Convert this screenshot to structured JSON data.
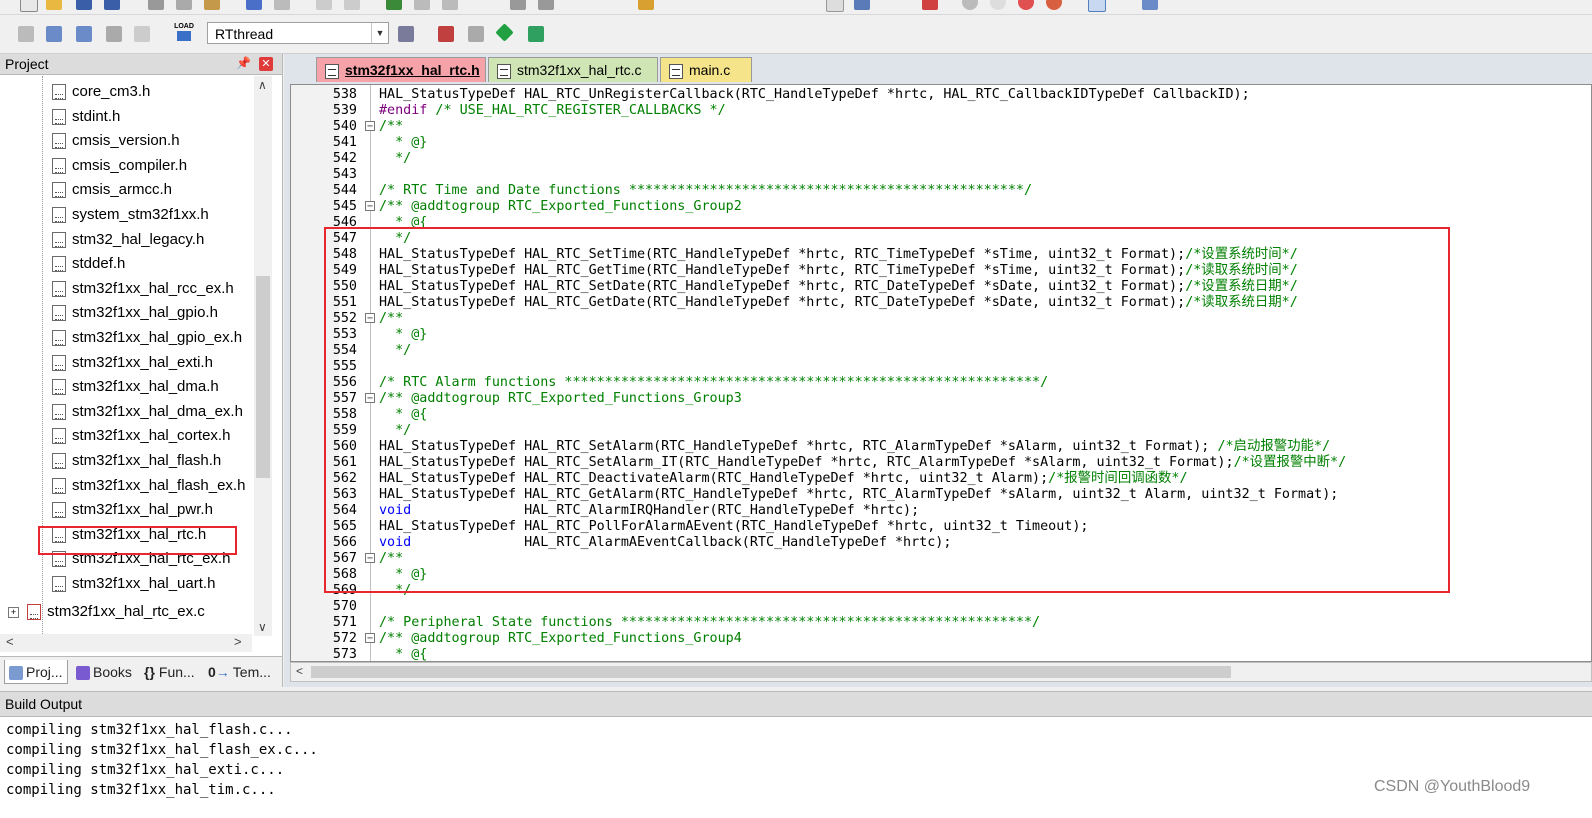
{
  "toolbar": {
    "target_name": "RTthread",
    "load_label": "LOAD"
  },
  "project_panel": {
    "title": "Project",
    "files": [
      "core_cm3.h",
      "stdint.h",
      "cmsis_version.h",
      "cmsis_compiler.h",
      "cmsis_armcc.h",
      "system_stm32f1xx.h",
      "stm32_hal_legacy.h",
      "stddef.h",
      "stm32f1xx_hal_rcc_ex.h",
      "stm32f1xx_hal_gpio.h",
      "stm32f1xx_hal_gpio_ex.h",
      "stm32f1xx_hal_exti.h",
      "stm32f1xx_hal_dma.h",
      "stm32f1xx_hal_dma_ex.h",
      "stm32f1xx_hal_cortex.h",
      "stm32f1xx_hal_flash.h",
      "stm32f1xx_hal_flash_ex.h",
      "stm32f1xx_hal_pwr.h",
      "stm32f1xx_hal_rtc.h",
      "stm32f1xx_hal_rtc_ex.h",
      "stm32f1xx_hal_uart.h"
    ],
    "group_item": "stm32f1xx_hal_rtc_ex.c",
    "tabs": [
      "Proj...",
      "Books",
      "Fun...",
      "Tem..."
    ]
  },
  "editor": {
    "tabs": [
      "stm32f1xx_hal_rtc.h",
      "stm32f1xx_hal_rtc.c",
      "main.c"
    ],
    "lines": [
      {
        "n": "538",
        "fold": "",
        "segs": [
          {
            "t": "HAL_StatusTypeDef HAL_RTC_UnRegisterCallback(RTC_HandleTypeDef *hrtc, HAL_RTC_CallbackIDTypeDef CallbackID);",
            "c": ""
          }
        ]
      },
      {
        "n": "539",
        "fold": "",
        "segs": [
          {
            "t": "#endif",
            "c": "pp"
          },
          {
            "t": " /* USE_HAL_RTC_REGISTER_CALLBACKS */",
            "c": "cm"
          }
        ]
      },
      {
        "n": "540",
        "fold": "-",
        "segs": [
          {
            "t": "/**",
            "c": "cm"
          }
        ]
      },
      {
        "n": "541",
        "fold": "",
        "segs": [
          {
            "t": "  * @}",
            "c": "cm"
          }
        ]
      },
      {
        "n": "542",
        "fold": "",
        "segs": [
          {
            "t": "  */",
            "c": "cm"
          }
        ]
      },
      {
        "n": "543",
        "fold": "",
        "segs": [
          {
            "t": "",
            "c": ""
          }
        ]
      },
      {
        "n": "544",
        "fold": "",
        "segs": [
          {
            "t": "/* RTC Time and Date functions *************************************************/",
            "c": "cm"
          }
        ]
      },
      {
        "n": "545",
        "fold": "-",
        "segs": [
          {
            "t": "/** @addtogroup RTC_Exported_Functions_Group2",
            "c": "cm"
          }
        ]
      },
      {
        "n": "546",
        "fold": "",
        "segs": [
          {
            "t": "  * @{",
            "c": "cm"
          }
        ]
      },
      {
        "n": "547",
        "fold": "",
        "segs": [
          {
            "t": "  */",
            "c": "cm"
          }
        ]
      },
      {
        "n": "548",
        "fold": "",
        "segs": [
          {
            "t": "HAL_StatusTypeDef HAL_RTC_SetTime(RTC_HandleTypeDef *hrtc, RTC_TimeTypeDef *sTime, uint32_t Format);",
            "c": ""
          },
          {
            "t": "/*设置系统时间*/",
            "c": "cm"
          }
        ]
      },
      {
        "n": "549",
        "fold": "",
        "segs": [
          {
            "t": "HAL_StatusTypeDef HAL_RTC_GetTime(RTC_HandleTypeDef *hrtc, RTC_TimeTypeDef *sTime, uint32_t Format);",
            "c": ""
          },
          {
            "t": "/*读取系统时间*/",
            "c": "cm"
          }
        ]
      },
      {
        "n": "550",
        "fold": "",
        "segs": [
          {
            "t": "HAL_StatusTypeDef HAL_RTC_SetDate(RTC_HandleTypeDef *hrtc, RTC_DateTypeDef *sDate, uint32_t Format);",
            "c": ""
          },
          {
            "t": "/*设置系统日期*/",
            "c": "cm"
          }
        ]
      },
      {
        "n": "551",
        "fold": "",
        "segs": [
          {
            "t": "HAL_StatusTypeDef HAL_RTC_GetDate(RTC_HandleTypeDef *hrtc, RTC_DateTypeDef *sDate, uint32_t Format);",
            "c": ""
          },
          {
            "t": "/*读取系统日期*/",
            "c": "cm"
          }
        ]
      },
      {
        "n": "552",
        "fold": "-",
        "segs": [
          {
            "t": "/**",
            "c": "cm"
          }
        ]
      },
      {
        "n": "553",
        "fold": "",
        "segs": [
          {
            "t": "  * @}",
            "c": "cm"
          }
        ]
      },
      {
        "n": "554",
        "fold": "",
        "segs": [
          {
            "t": "  */",
            "c": "cm"
          }
        ]
      },
      {
        "n": "555",
        "fold": "",
        "segs": [
          {
            "t": "",
            "c": ""
          }
        ]
      },
      {
        "n": "556",
        "fold": "",
        "segs": [
          {
            "t": "/* RTC Alarm functions ***********************************************************/",
            "c": "cm"
          }
        ]
      },
      {
        "n": "557",
        "fold": "-",
        "segs": [
          {
            "t": "/** @addtogroup RTC_Exported_Functions_Group3",
            "c": "cm"
          }
        ]
      },
      {
        "n": "558",
        "fold": "",
        "segs": [
          {
            "t": "  * @{",
            "c": "cm"
          }
        ]
      },
      {
        "n": "559",
        "fold": "",
        "segs": [
          {
            "t": "  */",
            "c": "cm"
          }
        ]
      },
      {
        "n": "560",
        "fold": "",
        "segs": [
          {
            "t": "HAL_StatusTypeDef HAL_RTC_SetAlarm(RTC_HandleTypeDef *hrtc, RTC_AlarmTypeDef *sAlarm, uint32_t Format); ",
            "c": ""
          },
          {
            "t": "/*启动报警功能*/",
            "c": "cm"
          }
        ]
      },
      {
        "n": "561",
        "fold": "",
        "segs": [
          {
            "t": "HAL_StatusTypeDef HAL_RTC_SetAlarm_IT(RTC_HandleTypeDef *hrtc, RTC_AlarmTypeDef *sAlarm, uint32_t Format);",
            "c": ""
          },
          {
            "t": "/*设置报警中断*/",
            "c": "cm"
          }
        ]
      },
      {
        "n": "562",
        "fold": "",
        "segs": [
          {
            "t": "HAL_StatusTypeDef HAL_RTC_DeactivateAlarm(RTC_HandleTypeDef *hrtc, uint32_t Alarm);",
            "c": ""
          },
          {
            "t": "/*报警时间回调函数*/",
            "c": "cm"
          }
        ]
      },
      {
        "n": "563",
        "fold": "",
        "segs": [
          {
            "t": "HAL_StatusTypeDef HAL_RTC_GetAlarm(RTC_HandleTypeDef *hrtc, RTC_AlarmTypeDef *sAlarm, uint32_t Alarm, uint32_t Format);",
            "c": ""
          }
        ]
      },
      {
        "n": "564",
        "fold": "",
        "segs": [
          {
            "t": "void",
            "c": "kw"
          },
          {
            "t": "              HAL_RTC_AlarmIRQHandler(RTC_HandleTypeDef *hrtc);",
            "c": ""
          }
        ]
      },
      {
        "n": "565",
        "fold": "",
        "segs": [
          {
            "t": "HAL_StatusTypeDef HAL_RTC_PollForAlarmAEvent(RTC_HandleTypeDef *hrtc, uint32_t Timeout);",
            "c": ""
          }
        ]
      },
      {
        "n": "566",
        "fold": "",
        "segs": [
          {
            "t": "void",
            "c": "kw"
          },
          {
            "t": "              HAL_RTC_AlarmAEventCallback(RTC_HandleTypeDef *hrtc);",
            "c": ""
          }
        ]
      },
      {
        "n": "567",
        "fold": "-",
        "segs": [
          {
            "t": "/**",
            "c": "cm"
          }
        ]
      },
      {
        "n": "568",
        "fold": "",
        "segs": [
          {
            "t": "  * @}",
            "c": "cm"
          }
        ]
      },
      {
        "n": "569",
        "fold": "",
        "segs": [
          {
            "t": "  */",
            "c": "cm"
          }
        ]
      },
      {
        "n": "570",
        "fold": "",
        "segs": [
          {
            "t": "",
            "c": ""
          }
        ]
      },
      {
        "n": "571",
        "fold": "",
        "segs": [
          {
            "t": "/* Peripheral State functions ***************************************************/",
            "c": "cm"
          }
        ]
      },
      {
        "n": "572",
        "fold": "-",
        "segs": [
          {
            "t": "/** @addtogroup RTC_Exported_Functions_Group4",
            "c": "cm"
          }
        ]
      },
      {
        "n": "573",
        "fold": "",
        "segs": [
          {
            "t": "  * @{",
            "c": "cm"
          }
        ]
      }
    ]
  },
  "build_output": {
    "title": "Build Output",
    "lines": [
      "compiling stm32f1xx_hal_flash.c...",
      "compiling stm32f1xx_hal_flash_ex.c...",
      "compiling stm32f1xx_hal_exti.c...",
      "compiling stm32f1xx_hal_tim.c..."
    ]
  },
  "watermark": "CSDN @YouthBlood9",
  "colors": {
    "comment": "#008000",
    "keyword": "#0000ff",
    "preprocessor": "#7f007f",
    "highlight_box": "#e8262e",
    "active_tab": "#f5a3a9",
    "c_tab": "#cfe6b4",
    "main_tab": "#f6e48a"
  }
}
